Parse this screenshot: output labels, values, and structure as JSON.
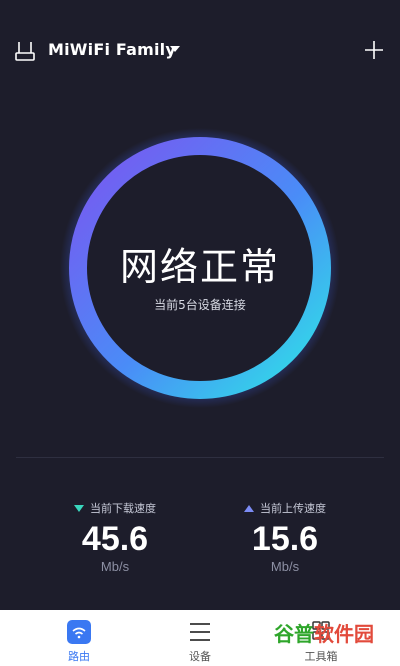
{
  "header": {
    "title": "MiWiFi Family"
  },
  "status": {
    "main": "网络正常",
    "sub": "当前5台设备连接"
  },
  "speeds": {
    "download": {
      "label": "当前下载速度",
      "value": "45.6",
      "unit": "Mb/s"
    },
    "upload": {
      "label": "当前上传速度",
      "value": "15.6",
      "unit": "Mb/s"
    }
  },
  "tabs": [
    {
      "label": "路由",
      "active": true
    },
    {
      "label": "设备",
      "active": false
    },
    {
      "label": "工具箱",
      "active": false
    }
  ],
  "watermark": {
    "part1": "谷普",
    "part2": "软件园"
  },
  "colors": {
    "background": "#1d1d2b",
    "ring_start": "#7b55f0",
    "ring_end": "#2ee6e6",
    "accent": "#3a78f2"
  }
}
